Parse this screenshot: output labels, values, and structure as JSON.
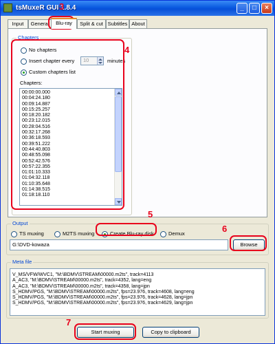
{
  "window": {
    "title": "tsMuxeR GUI 1.8.4"
  },
  "tabs": [
    {
      "label": "Input"
    },
    {
      "label": "General"
    },
    {
      "label": "Blu-ray"
    },
    {
      "label": "Split & cut"
    },
    {
      "label": "Subtitles"
    },
    {
      "label": "About"
    }
  ],
  "chapters": {
    "group_label": "Chapters",
    "no_chapters": "No chapters",
    "insert_every": "Insert chapter every",
    "insert_value": "10",
    "minutes": "minutes",
    "custom_list": "Custom chapters list",
    "list_label": "Chapters:",
    "list": [
      "00:00:00.000",
      "00:04:24.180",
      "00:09:14.887",
      "00:15:25.257",
      "00:18:20.182",
      "00:23:12.015",
      "00:28:04.516",
      "00:32:17.268",
      "00:36:18.593",
      "00:39:51.222",
      "00:44:40.803",
      "00:48:55.098",
      "00:52:42.576",
      "00:57:22.355",
      "01:01:10.333",
      "01:04:32.118",
      "01:10:35.648",
      "01:14:38.515",
      "01:18:18.110"
    ]
  },
  "output": {
    "group_label": "Output",
    "options": [
      "TS muxing",
      "M2TS muxing",
      "Create Blu-ray disk",
      "Demux"
    ],
    "path": "G:\\DVD-kowaza",
    "browse": "Browse"
  },
  "meta": {
    "group_label": "Meta file",
    "lines": [
      "V_MS/VFW/WVC1, \"M:\\BDMV\\STREAM\\00000.m2ts\", track=4113",
      "A_AC3, \"M:\\BDMV\\STREAM\\00000.m2ts\", track=4352, lang=eng",
      "A_AC3, \"M:\\BDMV\\STREAM\\00000.m2ts\", track=4358, lang=jpn",
      "S_HDMV/PGS, \"M:\\BDMV\\STREAM\\00000.m2ts\", fps=23.976, track=4608, lang=eng",
      "S_HDMV/PGS, \"M:\\BDMV\\STREAM\\00000.m2ts\", fps=23.976, track=4628, lang=jpn",
      "S_HDMV/PGS, \"M:\\BDMV\\STREAM\\00000.m2ts\", fps=23.976, track=4629, lang=jpn"
    ]
  },
  "actions": {
    "start": "Start muxing",
    "copy": "Copy to clipboard"
  },
  "annotations": [
    "3",
    "4",
    "5",
    "6",
    "7"
  ],
  "colors": {
    "annotation": "#e8001b",
    "titlebar": "#0a5ae0",
    "group_label": "#0046d5"
  }
}
